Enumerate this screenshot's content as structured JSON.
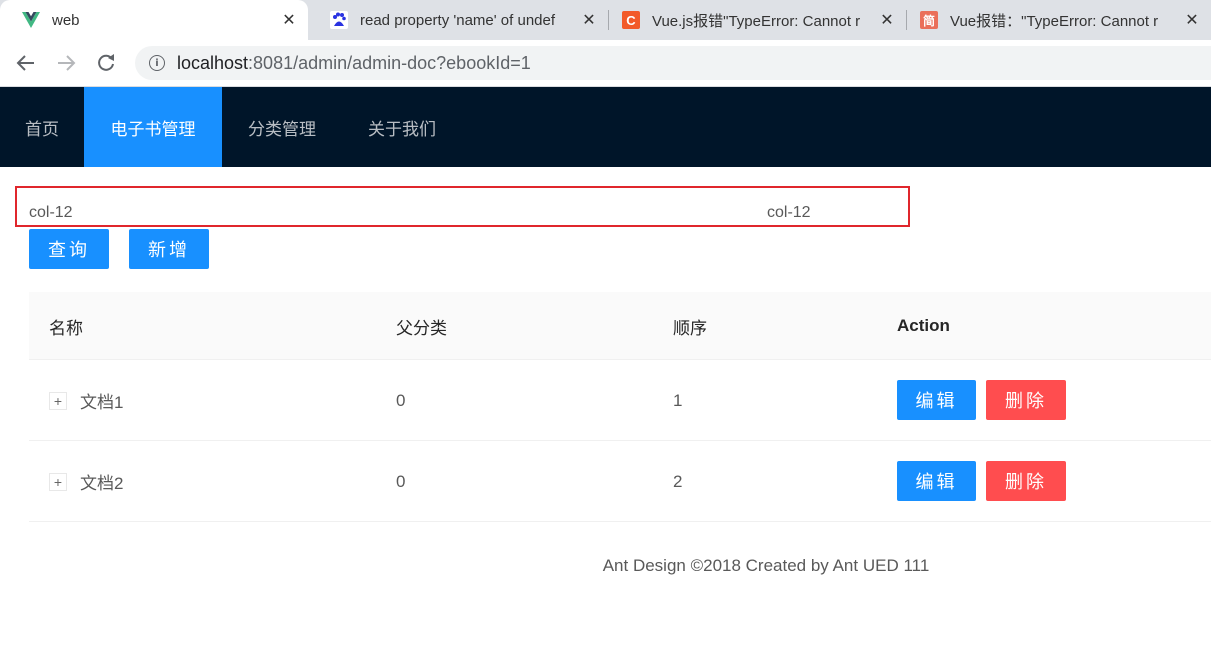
{
  "browser": {
    "tabs": [
      {
        "title": "web",
        "icon": "vue-logo-icon",
        "color": "#41b883"
      },
      {
        "title": "read property 'name' of undef",
        "icon": "baidu-paw-icon",
        "color": "#2932e1"
      },
      {
        "title": "Vue.js报错\"TypeError: Cannot r",
        "icon": "csdn-c-icon",
        "color": "#f25a29"
      },
      {
        "title": "Vue报错：\"TypeError: Cannot r",
        "icon": "jianshu-icon",
        "color": "#ea6f5a"
      }
    ],
    "url_host": "localhost",
    "url_rest": ":8081/admin/admin-doc?ebookId=1"
  },
  "header": {
    "menu": [
      {
        "label": "首页"
      },
      {
        "label": "电子书管理"
      },
      {
        "label": "分类管理"
      },
      {
        "label": "关于我们"
      }
    ]
  },
  "grid": {
    "left": "col-12",
    "right": "col-12"
  },
  "actions": {
    "query": "查询",
    "add": "新增"
  },
  "table": {
    "columns": [
      "名称",
      "父分类",
      "顺序",
      "Action"
    ],
    "rows": [
      {
        "name": "文档1",
        "parent": "0",
        "sort": "1",
        "edit": "编辑",
        "delete": "删除"
      },
      {
        "name": "文档2",
        "parent": "0",
        "sort": "2",
        "edit": "编辑",
        "delete": "删除"
      }
    ],
    "expand_symbol": "+"
  },
  "footer": {
    "text": "Ant Design ©2018 Created by Ant UED 111"
  },
  "colors": {
    "primary": "#1890ff",
    "danger": "#ff4d4f",
    "header_bg": "#001529",
    "highlight_border": "#e0262c"
  }
}
